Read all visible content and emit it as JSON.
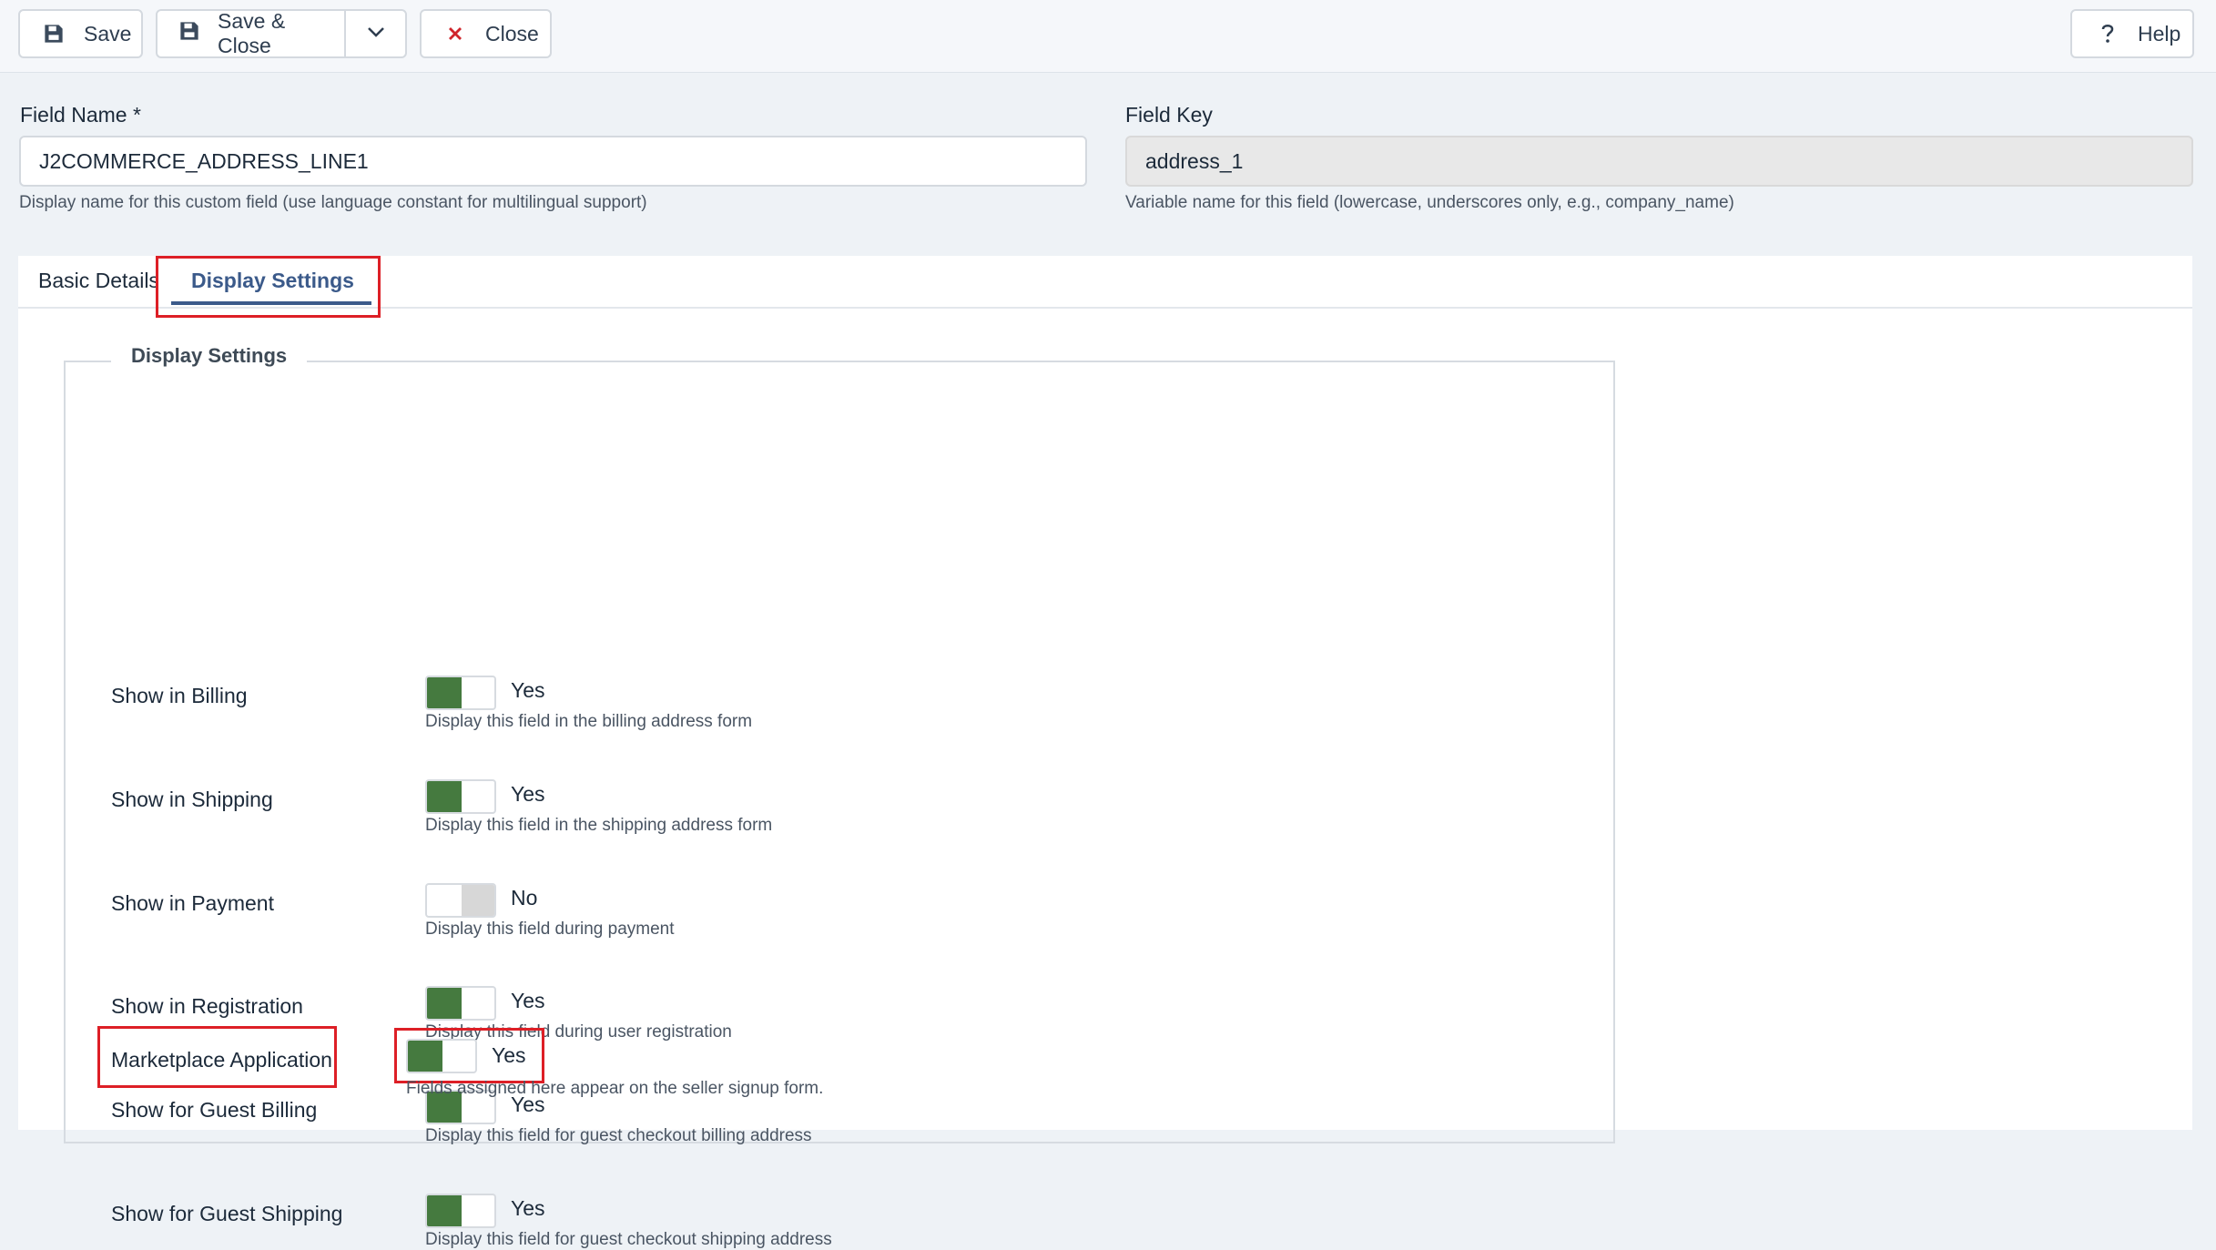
{
  "toolbar": {
    "save_label": "Save",
    "save_close_label": "Save & Close",
    "close_label": "Close",
    "help_label": "Help",
    "icons": {
      "save": "floppy-disk-icon",
      "dropdown": "chevron-down-icon",
      "close": "x-icon",
      "help": "question-mark-icon"
    },
    "colors": {
      "close_icon": "#d0242b"
    }
  },
  "field_name": {
    "label": "Field Name *",
    "value": "J2COMMERCE_ADDRESS_LINE1",
    "help": "Display name for this custom field (use language constant for multilingual support)"
  },
  "field_key": {
    "label": "Field Key",
    "value": "address_1",
    "help": "Variable name for this field (lowercase, underscores only, e.g., company_name)"
  },
  "tabs": [
    {
      "label": "Basic Details",
      "active": false
    },
    {
      "label": "Display Settings",
      "active": true
    }
  ],
  "display_settings": {
    "legend": "Display Settings",
    "settings": [
      {
        "label": "Show in Billing",
        "state": "Yes",
        "on": true,
        "help": "Display this field in the billing address form"
      },
      {
        "label": "Show in Shipping",
        "state": "Yes",
        "on": true,
        "help": "Display this field in the shipping address form"
      },
      {
        "label": "Show in Payment",
        "state": "No",
        "on": false,
        "help": "Display this field during payment"
      },
      {
        "label": "Show in Registration",
        "state": "Yes",
        "on": true,
        "help": "Display this field during user registration"
      },
      {
        "label": "Show for Guest Billing",
        "state": "Yes",
        "on": true,
        "help": "Display this field for guest checkout billing address"
      },
      {
        "label": "Show for Guest Shipping",
        "state": "Yes",
        "on": true,
        "help": "Display this field for guest checkout shipping address"
      },
      {
        "label": "Marketplace Application",
        "state": "Yes",
        "on": true,
        "help": "Fields assigned here appear on the seller signup form."
      }
    ]
  },
  "colors": {
    "toggle_on": "#457a3f",
    "toggle_off": "#d7d7d7",
    "active_tab": "#3b5a8a",
    "highlight_box": "#dd1f26"
  }
}
